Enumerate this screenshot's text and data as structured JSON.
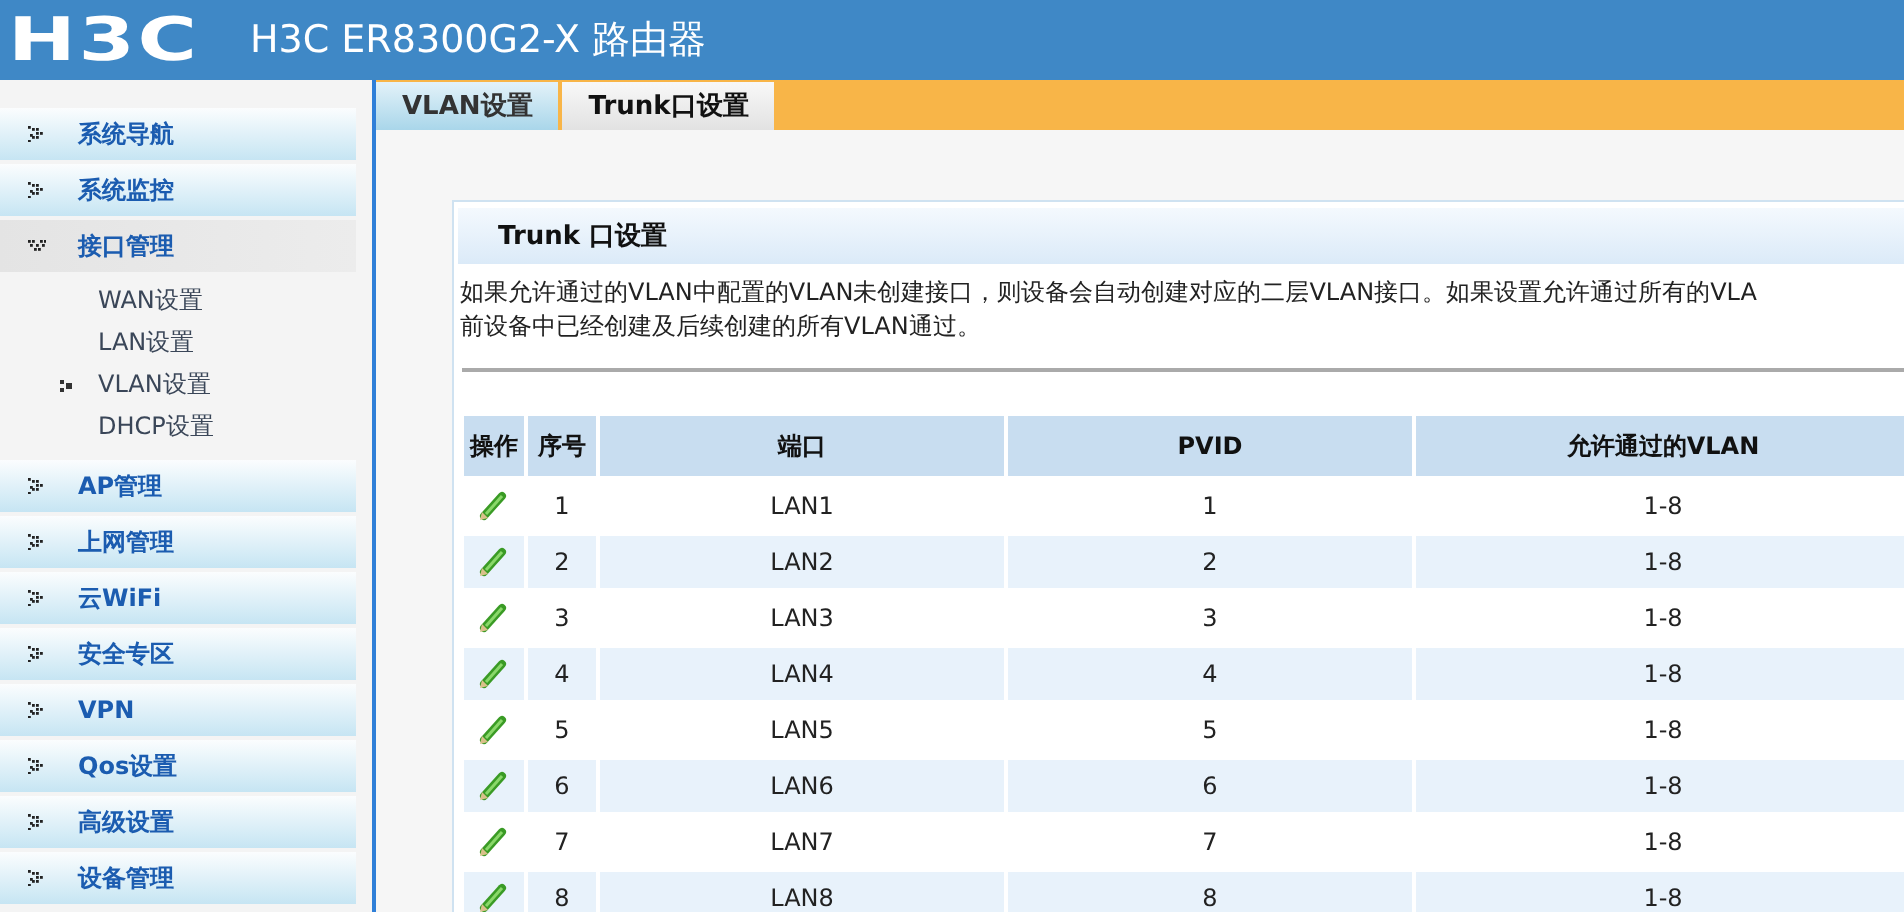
{
  "header": {
    "logo": "H3C",
    "title": "H3C ER8300G2-X 路由器"
  },
  "sidebar": {
    "items": [
      {
        "label": "系统导航",
        "expanded": false
      },
      {
        "label": "系统监控",
        "expanded": false
      },
      {
        "label": "接口管理",
        "expanded": true,
        "children": [
          {
            "label": "WAN设置",
            "selected": false
          },
          {
            "label": "LAN设置",
            "selected": false
          },
          {
            "label": "VLAN设置",
            "selected": true
          },
          {
            "label": "DHCP设置",
            "selected": false
          }
        ]
      },
      {
        "label": "AP管理",
        "expanded": false
      },
      {
        "label": "上网管理",
        "expanded": false
      },
      {
        "label": "云WiFi",
        "expanded": false
      },
      {
        "label": "安全专区",
        "expanded": false
      },
      {
        "label": "VPN",
        "expanded": false
      },
      {
        "label": "Qos设置",
        "expanded": false
      },
      {
        "label": "高级设置",
        "expanded": false
      },
      {
        "label": "设备管理",
        "expanded": false
      }
    ]
  },
  "tabs": [
    {
      "label": "VLAN设置",
      "selected": false
    },
    {
      "label": "Trunk口设置",
      "selected": true
    }
  ],
  "panel": {
    "title": "Trunk 口设置",
    "description": [
      "如果允许通过的VLAN中配置的VLAN未创建接口，则设备会自动创建对应的二层VLAN接口。如果设置允许通过所有的VLA",
      "前设备中已经创建及后续创建的所有VLAN通过。"
    ]
  },
  "table": {
    "columns": [
      "操作",
      "序号",
      "端口",
      "PVID",
      "允许通过的VLAN"
    ],
    "rows": [
      [
        "",
        "1",
        "LAN1",
        "1",
        "1-8"
      ],
      [
        "",
        "2",
        "LAN2",
        "2",
        "1-8"
      ],
      [
        "",
        "3",
        "LAN3",
        "3",
        "1-8"
      ],
      [
        "",
        "4",
        "LAN4",
        "4",
        "1-8"
      ],
      [
        "",
        "5",
        "LAN5",
        "5",
        "1-8"
      ],
      [
        "",
        "6",
        "LAN6",
        "6",
        "1-8"
      ],
      [
        "",
        "7",
        "LAN7",
        "7",
        "1-8"
      ],
      [
        "",
        "8",
        "LAN8",
        "8",
        "1-8"
      ]
    ]
  }
}
